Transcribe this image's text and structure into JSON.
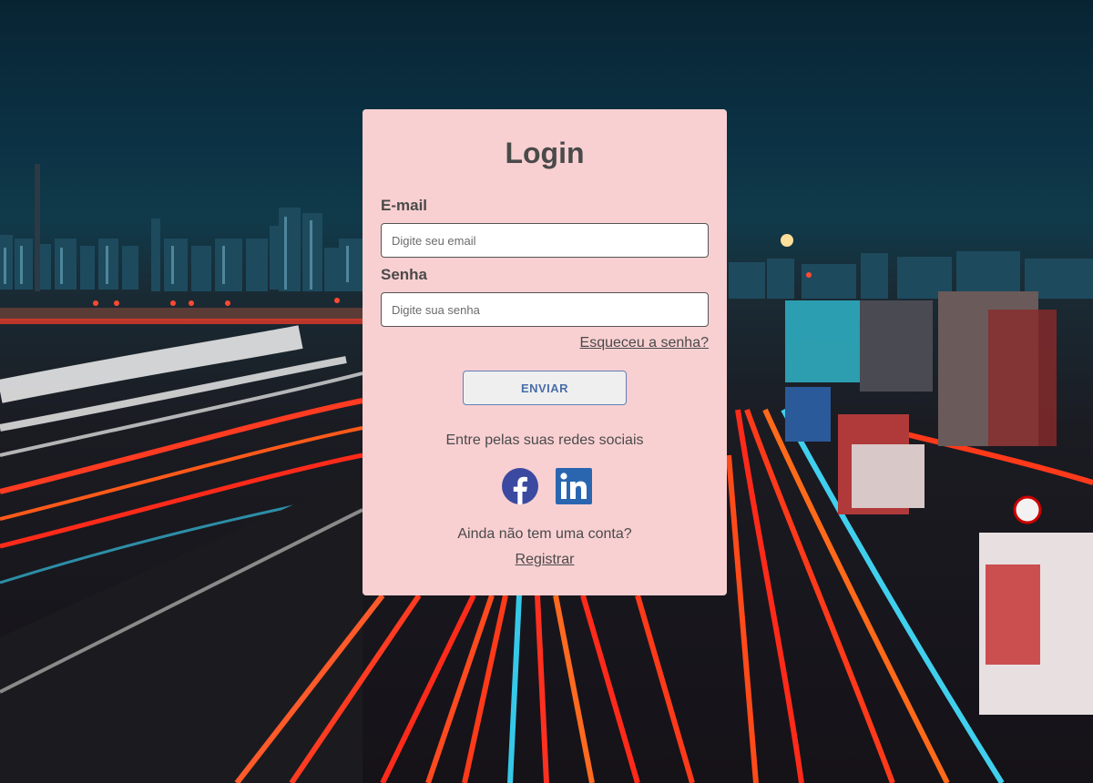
{
  "login": {
    "title": "Login",
    "email_label": "E-mail",
    "email_placeholder": "Digite seu email",
    "email_value": "",
    "password_label": "Senha",
    "password_placeholder": "Digite sua senha",
    "password_value": "",
    "forgot_label": "Esqueceu a senha?",
    "submit_label": "ENVIAR",
    "social_text": "Entre pelas suas redes sociais",
    "social_icons": [
      "facebook-icon",
      "linkedin-icon"
    ],
    "no_account_text": "Ainda não tem uma conta?",
    "register_label": "Registrar"
  },
  "colors": {
    "card_background": "#f9d0d2",
    "text": "#4a4a4a",
    "submit_text": "#4a6ea8",
    "facebook": "#3b4aa0",
    "linkedin": "#2a66b0"
  }
}
